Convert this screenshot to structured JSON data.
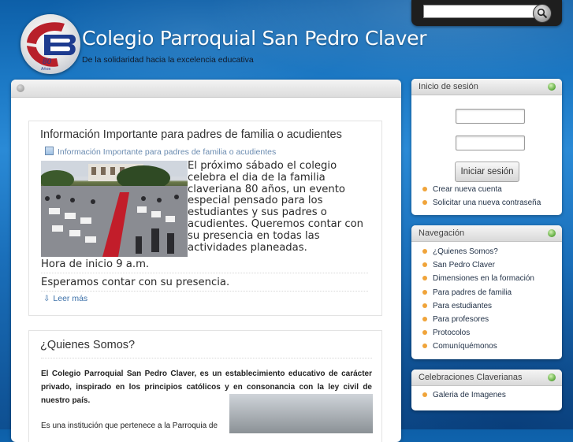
{
  "header": {
    "site_title": "Colegio Parroquial San Pedro Claver",
    "slogan": "De la solidaridad hacia la excelencia educativa",
    "logo_years": "80",
    "logo_years_word": "Años"
  },
  "search": {
    "value": "",
    "button_icon": "search-icon"
  },
  "main": {
    "node1": {
      "title": "Información Importante para padres de familia o acudientes",
      "category": "Información Importante para padres de familia o acudientes",
      "body": "El próximo sábado el colegio celebra el dia de la familia claveriana 80 años, un evento especial pensado para los estudiantes y sus padres o acudientes. Queremos contar con su presencia en todas las actividades planeadas.",
      "line1": "Hora de inicio 9 a.m.",
      "line2": "Esperamos contar con su presencia.",
      "read_more": "Leer más"
    },
    "node2": {
      "title": "¿Quienes Somos?",
      "para1": "El Colegio Parroquial San Pedro Claver, es un establecimiento educativo de carácter privado, inspirado en los principios católicos y en consonancia con la ley civil de nuestro país.",
      "para2": "Es una institución que pertenece a la Parroquia de"
    }
  },
  "sidebar": {
    "login": {
      "title": "Inicio de sesión",
      "button": "Iniciar sesión",
      "links": [
        "Crear nueva cuenta",
        "Solicitar una nueva contraseña"
      ]
    },
    "nav": {
      "title": "Navegación",
      "items": [
        "¿Quienes Somos?",
        "San Pedro Claver",
        "Dimensiones en la formación",
        "Para padres de familia",
        "Para estudiantes",
        "Para profesores",
        "Protocolos",
        "Comuníquémonos"
      ]
    },
    "celebrations": {
      "title": "Celebraciones Claverianas",
      "items": [
        "Galeria de Imagenes"
      ]
    }
  },
  "colors": {
    "background": "#1b78c4",
    "bullet": "#f0a43a",
    "link": "#3a6fa8",
    "logo_red": "#b8202a",
    "logo_blue": "#1d3b8f"
  }
}
